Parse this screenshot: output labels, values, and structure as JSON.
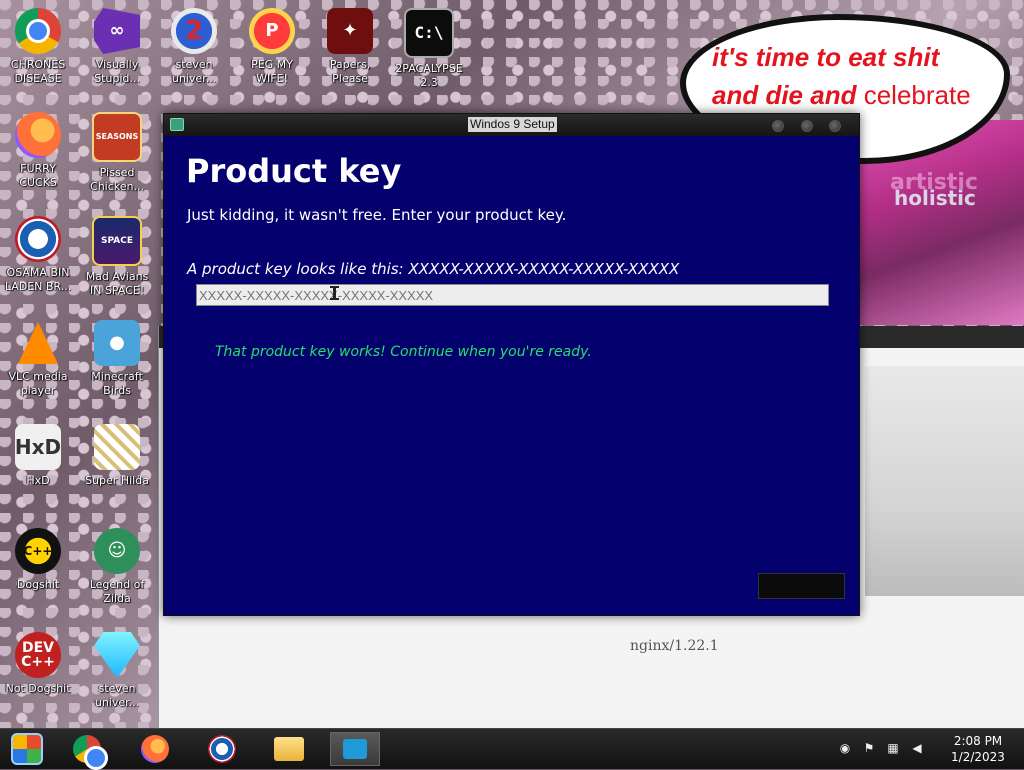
{
  "desktop": {
    "icons": [
      {
        "label": "CHRONES DISEASE",
        "icon": "chrome-icon"
      },
      {
        "label": "Visually Stupid...",
        "icon": "visual-studio-icon"
      },
      {
        "label": "steven univer...",
        "icon": "steven-universe-icon"
      },
      {
        "label": "PEG MY WIFE!",
        "icon": "peggle-icon"
      },
      {
        "label": "Papers, Please",
        "icon": "papers-please-icon"
      },
      {
        "label": "2PACALYPSE 2.3",
        "icon": "cmd-icon",
        "glyph": "C:\\"
      },
      {
        "label": "FURRY CUCKS",
        "icon": "firefox-icon"
      },
      {
        "label": "Pissed Chicken...",
        "icon": "angry-birds-seasons-icon",
        "glyph": "SEASONS"
      },
      {
        "label": "OSAMA BIN LADEN BR...",
        "icon": "obama-logo-icon"
      },
      {
        "label": "Mad Avians IN SPACE!",
        "icon": "angry-birds-space-icon",
        "glyph": "SPACE"
      },
      {
        "label": "VLC media player",
        "icon": "vlc-cone-icon"
      },
      {
        "label": "Minecraft Birds",
        "icon": "angry-bird-icon"
      },
      {
        "label": "HxD",
        "icon": "hxd-icon",
        "glyph": "HxD"
      },
      {
        "label": "Super Hilda",
        "icon": "pixel-dog-icon"
      },
      {
        "label": "Dogshit",
        "icon": "cpp-icon",
        "glyph": "C++"
      },
      {
        "label": "Legend of Zilda",
        "icon": "zelda-character-icon"
      },
      {
        "label": "Not Dogshit",
        "icon": "dev-cpp-icon",
        "glyph": "DEV C++"
      },
      {
        "label": "steven univer...",
        "icon": "diamond-icon"
      }
    ]
  },
  "wallpaper": {
    "speech_bubble_line1": "it's time to eat shit",
    "speech_bubble_line2_bold": "and die and",
    "speech_bubble_line2_plain": "celebrate",
    "art_text_1": "artistic",
    "art_text_2": "holistic"
  },
  "background_page": {
    "server_text": "nginx/1.22.1"
  },
  "setup_window": {
    "title": "Windos 9 Setup",
    "heading": "Product key",
    "subtitle": "Just kidding, it wasn't free. Enter your product key.",
    "hint": "A product key looks like this: XXXXX-XXXXX-XXXXX-XXXXX-XXXXX",
    "input_placeholder": "XXXXX-XXXXX-XXXXX-XXXXX-XXXXX",
    "input_value": "",
    "status_message": "That product key works! Continue when you're ready.",
    "status_color": "#22e06b",
    "background_color": "#04006e",
    "next_button_label": ""
  },
  "taskbar": {
    "items": [
      {
        "name": "start",
        "icon": "start-icon"
      },
      {
        "name": "chrome",
        "icon": "chrome-icon"
      },
      {
        "name": "firefox",
        "icon": "firefox-icon"
      },
      {
        "name": "obama",
        "icon": "obama-logo-icon"
      },
      {
        "name": "file-explorer",
        "icon": "folder-icon"
      },
      {
        "name": "setup",
        "icon": "setup-icon"
      }
    ],
    "clock_time": "2:08 PM",
    "clock_date": "1/2/2023",
    "tray_icons": [
      "obama-logo-icon",
      "flag-icon",
      "network-icon",
      "volume-icon"
    ]
  }
}
